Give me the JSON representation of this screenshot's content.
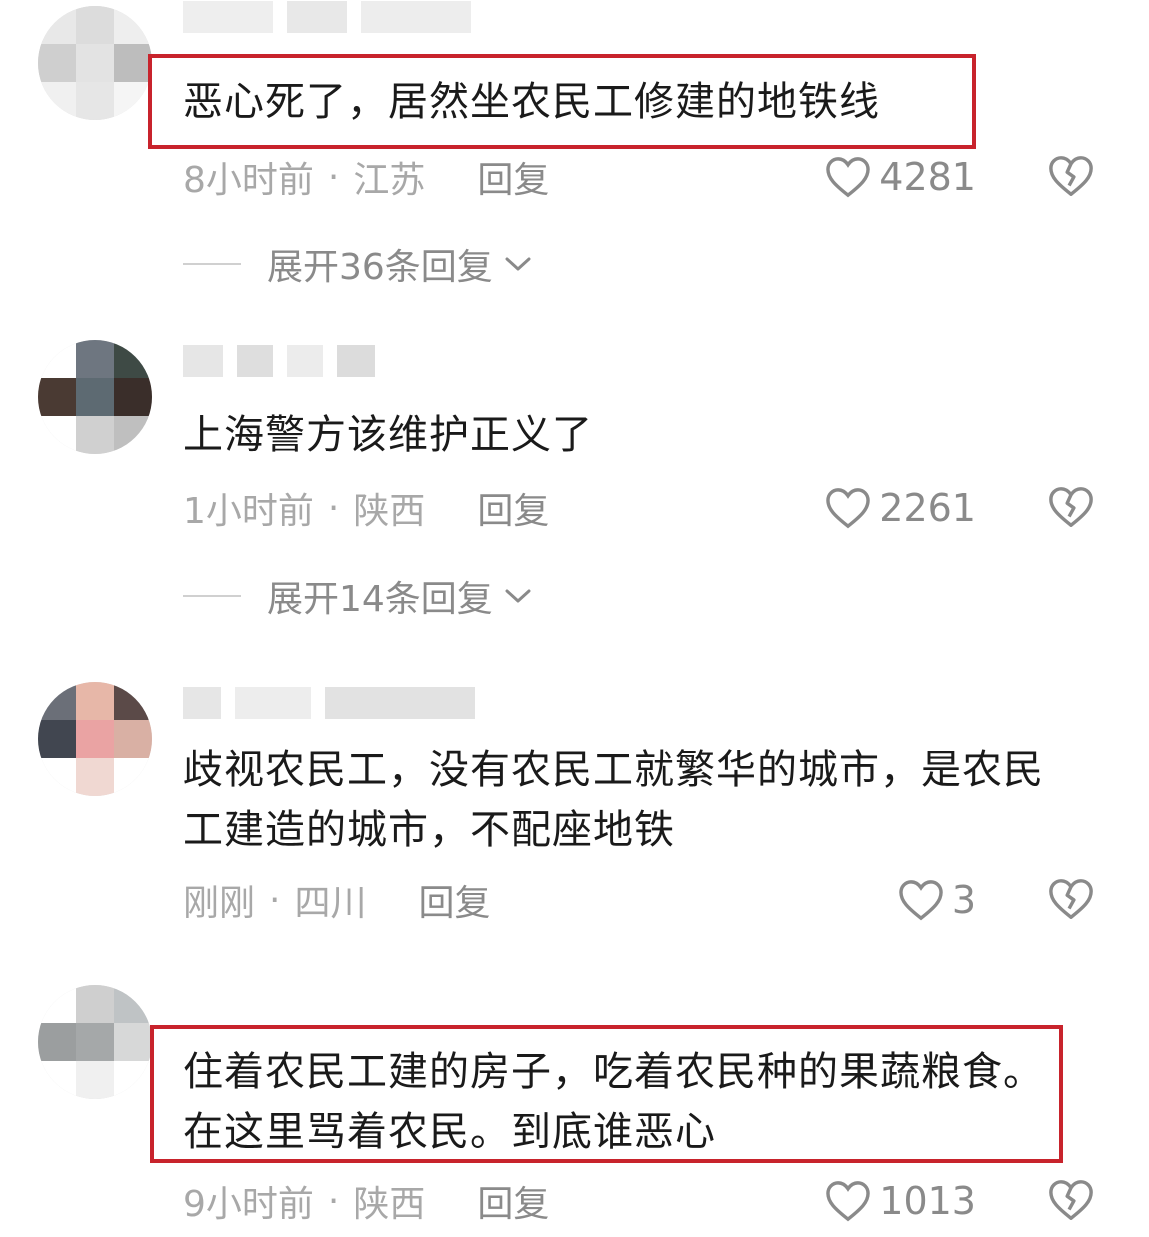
{
  "comments": [
    {
      "text": "恶心死了，居然坐农民工修建的地铁线",
      "time": "8小时前",
      "location": "江苏",
      "reply_label": "回复",
      "likes": "4281",
      "expand_label": "展开36条回复"
    },
    {
      "text": "上海警方该维护正义了",
      "time": "1小时前",
      "location": "陕西",
      "reply_label": "回复",
      "likes": "2261",
      "expand_label": "展开14条回复"
    },
    {
      "text": "歧视农民工，没有农民工就繁华的城市，是农民工建造的城市，不配座地铁",
      "time": "刚刚",
      "location": "四川",
      "reply_label": "回复",
      "likes": "3"
    },
    {
      "text": "住着农民工建的房子，吃着农民种的果蔬粮食。在这里骂着农民。到底谁恶心",
      "time": "9小时前",
      "location": "陕西",
      "reply_label": "回复",
      "likes": "1013"
    }
  ],
  "separator": "·",
  "colors": {
    "highlight_border": "#c8232c",
    "text": "#1a1a1a",
    "meta": "#a8a8a8"
  },
  "icons": {
    "like": "heart-outline-icon",
    "dislike": "broken-heart-icon",
    "expand": "chevron-down-icon"
  }
}
